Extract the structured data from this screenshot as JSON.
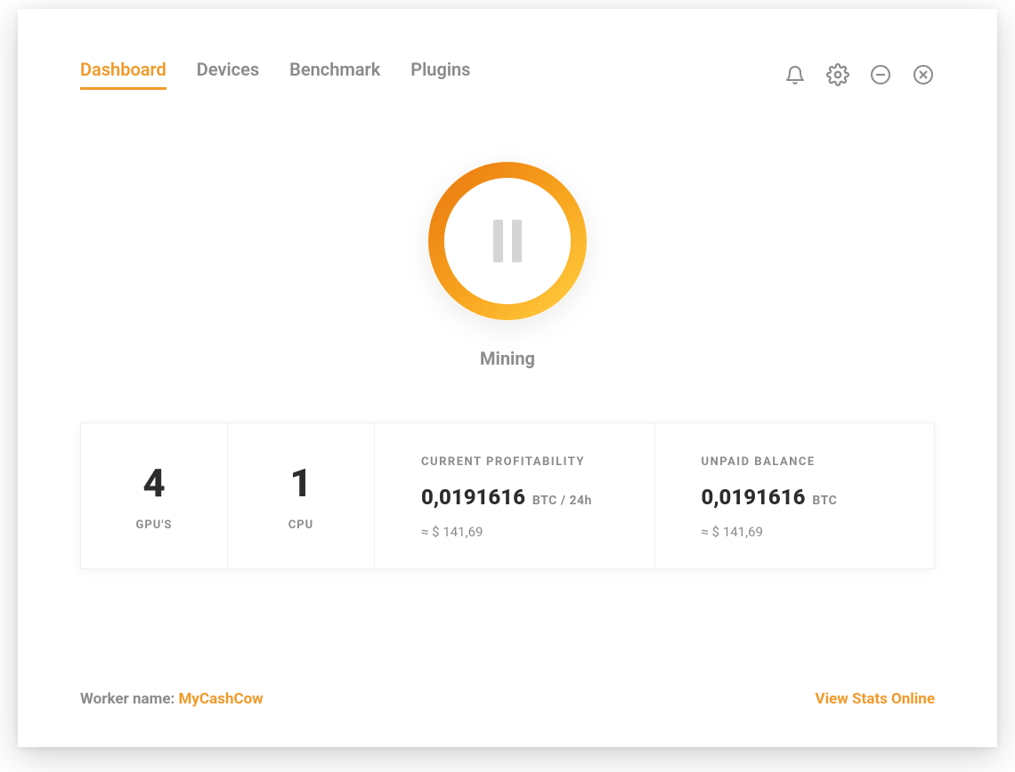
{
  "tabs": [
    {
      "label": "Dashboard",
      "active": true
    },
    {
      "label": "Devices",
      "active": false
    },
    {
      "label": "Benchmark",
      "active": false
    },
    {
      "label": "Plugins",
      "active": false
    }
  ],
  "mining": {
    "status_label": "Mining"
  },
  "stats": {
    "gpu": {
      "value": "4",
      "label": "GPU'S"
    },
    "cpu": {
      "value": "1",
      "label": "CPU"
    },
    "profitability": {
      "label": "CURRENT PROFITABILITY",
      "value": "0,0191616",
      "unit": "BTC  / 24h",
      "approx": "≈ $ 141,69"
    },
    "balance": {
      "label": "UNPAID BALANCE",
      "value": "0,0191616",
      "unit": "BTC",
      "approx": "≈ $ 141,69"
    }
  },
  "footer": {
    "worker_label": "Worker name: ",
    "worker_value": "MyCashCow",
    "view_stats": "View Stats Online"
  },
  "colors": {
    "accent": "#f19a2a",
    "accent_dark": "#ea7e12",
    "accent_light": "#ffc23d",
    "text_muted": "#8b8b8b",
    "text_strong": "#2c2c2c"
  }
}
